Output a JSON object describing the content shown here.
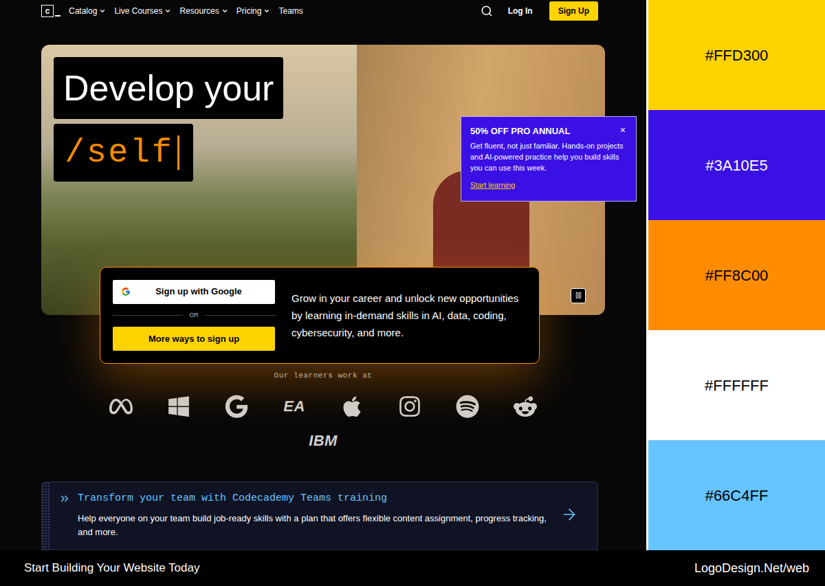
{
  "nav": {
    "logo": "c",
    "items": [
      {
        "label": "Catalog",
        "dropdown": true
      },
      {
        "label": "Live Courses",
        "dropdown": true
      },
      {
        "label": "Resources",
        "dropdown": true
      },
      {
        "label": "Pricing",
        "dropdown": true
      },
      {
        "label": "Teams",
        "dropdown": false
      }
    ],
    "login": "Log In",
    "signup": "Sign Up"
  },
  "hero": {
    "headline": "Develop your",
    "typed": "/self",
    "video_playing": true,
    "promo": {
      "title": "50% OFF PRO ANNUAL",
      "close": "×",
      "body": "Get fluent, not just familiar. Hands-on projects and AI-powered practice help you build skills you can use this week.",
      "link": "Start learning"
    }
  },
  "signup": {
    "google": "Sign up with Google",
    "divider": "OR",
    "more": "More ways to sign up",
    "blurb": "Grow in your career and unlock new opportunities by learning in-demand skills in AI, data, coding, cybersecurity, and more."
  },
  "learners": {
    "heading": "Our learners work at",
    "logos": [
      {
        "kind": "meta"
      },
      {
        "kind": "windows"
      },
      {
        "kind": "google"
      },
      {
        "kind": "text",
        "text": "EA"
      },
      {
        "kind": "apple"
      },
      {
        "kind": "instagram"
      },
      {
        "kind": "spotify"
      },
      {
        "kind": "reddit"
      }
    ],
    "second_row": [
      {
        "kind": "text",
        "text": "IBM"
      }
    ]
  },
  "teams_banner": {
    "title": "Transform your team with Codecademy Teams training",
    "body": "Help everyone on your team build job-ready skills with a plan that offers flexible content assignment, progress tracking, and more."
  },
  "palette": [
    {
      "hex": "#FFD300",
      "color": "#FFD300"
    },
    {
      "hex": "#3A10E5",
      "color": "#3A10E5"
    },
    {
      "hex": "#FF8C00",
      "color": "#FF8C00"
    },
    {
      "hex": "#FFFFFF",
      "color": "#FFFFFF"
    },
    {
      "hex": "#66C4FF",
      "color": "#66C4FF"
    }
  ],
  "footer": {
    "tagline": "Start Building Your Website Today",
    "site": "LogoDesign.Net/web"
  }
}
